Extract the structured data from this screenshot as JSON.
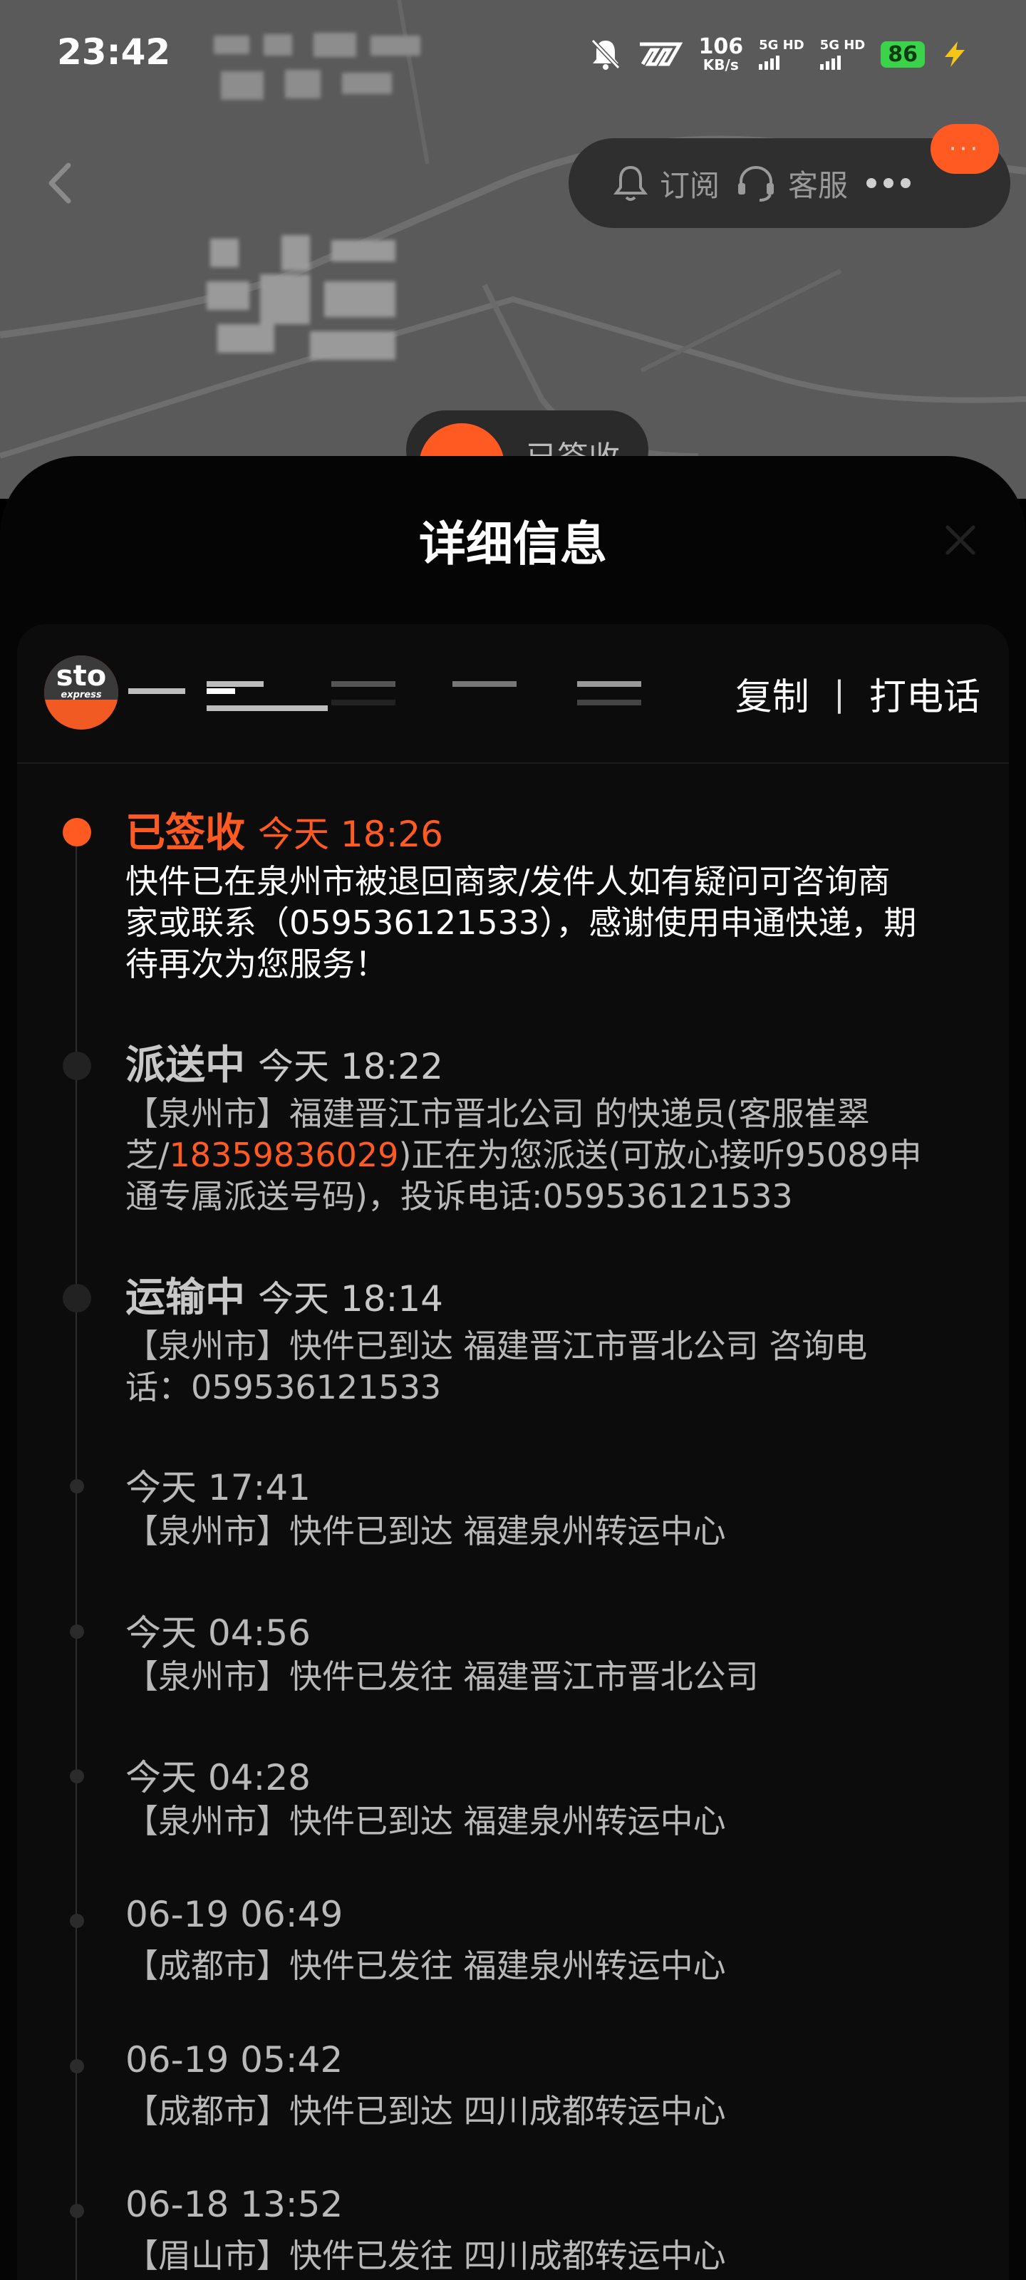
{
  "status_bar": {
    "time": "23:42",
    "net_speed": "106",
    "net_unit": "KB/s",
    "sim1": "5G HD",
    "sim2": "5G HD",
    "battery": "86",
    "icons": [
      "mute-bell-icon",
      "app-7-icon",
      "charging-bolt-icon"
    ]
  },
  "header": {
    "subscribe_label": "订阅",
    "service_label": "客服",
    "icons": [
      "back-chevron-icon",
      "bell-icon",
      "headset-icon",
      "more-dots-icon"
    ],
    "more_bubble_text": "···"
  },
  "map_chip": {
    "label": "已签收"
  },
  "sheet": {
    "title": "详细信息",
    "close_icon": "close-icon"
  },
  "courier": {
    "logo_text": "sto",
    "logo_subtext": "express",
    "copy_label": "复制",
    "separator": "|",
    "call_label": "打电话"
  },
  "colors": {
    "accent": "#ff5a22",
    "background": "#000000",
    "muted": "#b9b9b9"
  },
  "timeline": [
    {
      "status": "已签收",
      "time": "今天 18:26",
      "desc": "快件已在泉州市被退回商家/发件人如有疑问可咨询商家或联系（059536121533），感谢使用申通快递，期待再次为您服务！",
      "lines": [
        "快件已在泉州市被退回商家/发件人如有疑问可咨询商",
        "家或联系（059536121533），感谢使用申通快递，期",
        "待再次为您服务！"
      ]
    },
    {
      "status": "派送中",
      "time": "今天 18:22",
      "line1": "【泉州市】福建晋江市晋北公司 的快递员(客服崔翠",
      "line2_before": "芝/",
      "phone": "18359836029",
      "line2_after": ")正在为您派送(可放心接听95089申",
      "line3": "通专属派送号码)，投诉电话:059536121533"
    },
    {
      "status": "运输中",
      "time": "今天 18:14",
      "lines": [
        "【泉州市】快件已到达 福建晋江市晋北公司 咨询电",
        "话：059536121533"
      ]
    },
    {
      "time": "今天 17:41",
      "desc": "【泉州市】快件已到达 福建泉州转运中心"
    },
    {
      "time": "今天 04:56",
      "desc": "【泉州市】快件已发往 福建晋江市晋北公司"
    },
    {
      "time": "今天 04:28",
      "desc": "【泉州市】快件已到达 福建泉州转运中心"
    },
    {
      "time": "06-19 06:49",
      "desc": "【成都市】快件已发往 福建泉州转运中心"
    },
    {
      "time": "06-19 05:42",
      "desc": "【成都市】快件已到达 四川成都转运中心"
    },
    {
      "time": "06-18 13:52",
      "desc": "【眉山市】快件已发往 四川成都转运中心"
    }
  ]
}
